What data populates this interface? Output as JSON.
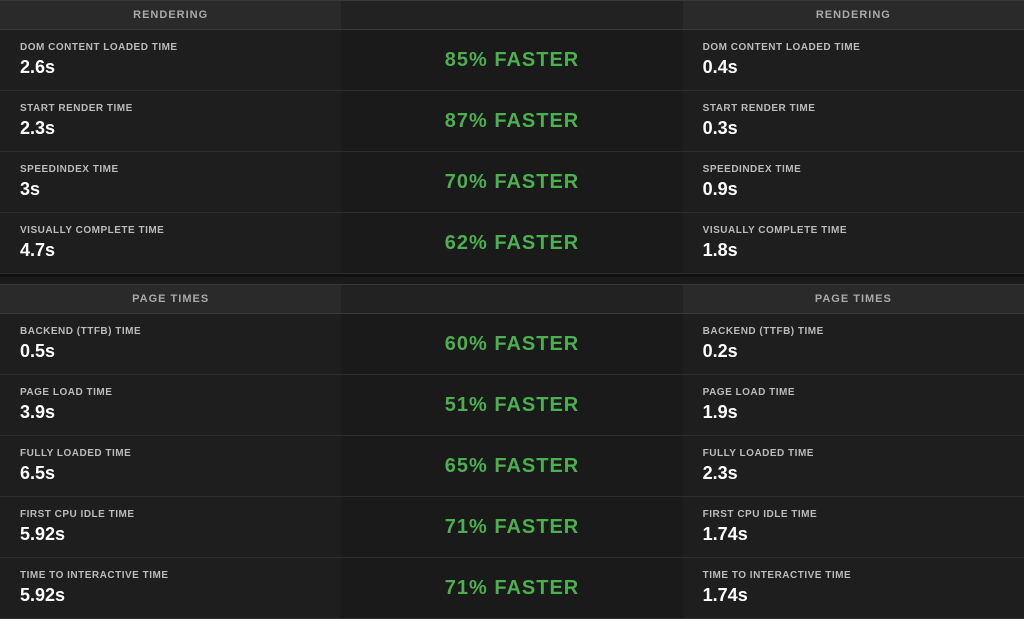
{
  "rendering": {
    "left_header": "RENDERING",
    "right_header": "RENDERING",
    "rows": [
      {
        "left_label": "DOM CONTENT LOADED TIME",
        "left_value": "2.6s",
        "faster_text": "85% FASTER",
        "right_label": "DOM CONTENT LOADED TIME",
        "right_value": "0.4s"
      },
      {
        "left_label": "START RENDER TIME",
        "left_value": "2.3s",
        "faster_text": "87% FASTER",
        "right_label": "START RENDER TIME",
        "right_value": "0.3s"
      },
      {
        "left_label": "SPEEDINDEX TIME",
        "left_value": "3s",
        "faster_text": "70% FASTER",
        "right_label": "SPEEDINDEX TIME",
        "right_value": "0.9s"
      },
      {
        "left_label": "VISUALLY COMPLETE TIME",
        "left_value": "4.7s",
        "faster_text": "62% FASTER",
        "right_label": "VISUALLY COMPLETE TIME",
        "right_value": "1.8s"
      }
    ]
  },
  "page_times": {
    "left_header": "PAGE TIMES",
    "right_header": "PAGE TIMES",
    "rows": [
      {
        "left_label": "BACKEND (TTFB) TIME",
        "left_value": "0.5s",
        "faster_text": "60% FASTER",
        "right_label": "BACKEND (TTFB) TIME",
        "right_value": "0.2s"
      },
      {
        "left_label": "PAGE LOAD TIME",
        "left_value": "3.9s",
        "faster_text": "51% FASTER",
        "right_label": "PAGE LOAD TIME",
        "right_value": "1.9s"
      },
      {
        "left_label": "FULLY LOADED TIME",
        "left_value": "6.5s",
        "faster_text": "65% FASTER",
        "right_label": "FULLY LOADED TIME",
        "right_value": "2.3s"
      },
      {
        "left_label": "FIRST CPU IDLE TIME",
        "left_value": "5.92s",
        "faster_text": "71% FASTER",
        "right_label": "FIRST CPU IDLE TIME",
        "right_value": "1.74s"
      },
      {
        "left_label": "TIME TO INTERACTIVE TIME",
        "left_value": "5.92s",
        "faster_text": "71% FASTER",
        "right_label": "TIME TO INTERACTIVE TIME",
        "right_value": "1.74s"
      }
    ]
  }
}
